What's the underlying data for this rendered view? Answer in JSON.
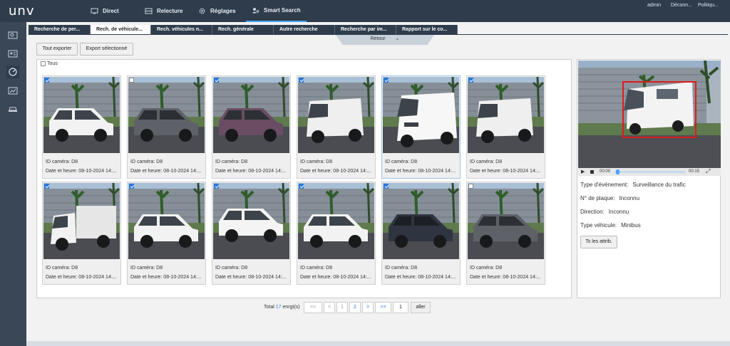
{
  "header": {
    "logo": "unv",
    "nav": [
      {
        "label": "Direct",
        "icon": "monitor-icon"
      },
      {
        "label": "Relecture",
        "icon": "film-icon"
      },
      {
        "label": "Réglages",
        "icon": "gear-icon"
      },
      {
        "label": "Smart Search",
        "icon": "person-search-icon"
      }
    ],
    "user": "admin",
    "logout": "Déconn...",
    "policy": "Politiqu..."
  },
  "sidebar": {
    "items": [
      "face-search-icon",
      "id-card-icon",
      "gauge-icon",
      "chart-icon",
      "car-icon"
    ]
  },
  "tabs": [
    "Recherche de per...",
    "Rech. de véhicule...",
    "Rech. véhicules n...",
    "Rech. générale",
    "Autre recherche",
    "Recherche par im...",
    "Rapport sur le co..."
  ],
  "retour": "Retour",
  "toolbar": {
    "export_all": "Tout exporter",
    "export_selected": "Export sélectionné"
  },
  "select_all": "Tous",
  "cards": [
    {
      "camera": "ID caméra: D8",
      "datetime": "Date et heure: 08-10-2024 14:...",
      "checked": true,
      "vehicle": "hatch-white"
    },
    {
      "camera": "ID caméra: D8",
      "datetime": "Date et heure: 08-10-2024 14:...",
      "checked": false,
      "vehicle": "car-grey"
    },
    {
      "camera": "ID caméra: D8",
      "datetime": "Date et heure: 08-10-2024 14:...",
      "checked": true,
      "vehicle": "car-purple"
    },
    {
      "camera": "ID caméra: D8",
      "datetime": "Date et heure: 08-10-2024 14:...",
      "checked": true,
      "vehicle": "van-small"
    },
    {
      "camera": "ID caméra: D8",
      "datetime": "Date et heure: 08-10-2024 14:...",
      "checked": true,
      "vehicle": "van-big"
    },
    {
      "camera": "ID caméra: D8",
      "datetime": "Date et heure: 08-10-2024 14:...",
      "checked": true,
      "vehicle": "van-small"
    },
    {
      "camera": "ID caméra: D8",
      "datetime": "Date et heure: 08-10-2024 14:...",
      "checked": true,
      "vehicle": "truck-white"
    },
    {
      "camera": "ID caméra: D8",
      "datetime": "Date et heure: 08-10-2024 14:...",
      "checked": true,
      "vehicle": "hatch-white"
    },
    {
      "camera": "ID caméra: D8",
      "datetime": "Date et heure: 08-10-2024 14:...",
      "checked": true,
      "vehicle": "suv-white"
    },
    {
      "camera": "ID caméra: D8",
      "datetime": "Date et heure: 08-10-2024 14:...",
      "checked": true,
      "vehicle": "hatch-white"
    },
    {
      "camera": "ID caméra: D8",
      "datetime": "Date et heure: 08-10-2024 14:...",
      "checked": true,
      "vehicle": "car-dark"
    },
    {
      "camera": "ID caméra: D8",
      "datetime": "Date et heure: 08-10-2024 14:...",
      "checked": false,
      "vehicle": "car-grey"
    }
  ],
  "pagination": {
    "total_prefix": "Total",
    "total": "17",
    "total_suffix": "enrgt(s)",
    "first": "<<",
    "prev": "<",
    "page1": "1",
    "page2": "2",
    "next": ">",
    "last": ">>",
    "goto_value": "1",
    "go": "aller"
  },
  "detail": {
    "time_start": "00:00",
    "time_end": "00:15",
    "event_type_label": "Type d'événement:",
    "event_type": "Surveillance du trafic",
    "plate_label": "N° de plaque:",
    "plate": "Inconnu",
    "direction_label": "Direction:",
    "direction": "Inconnu",
    "vehicle_type_label": "Type véhicule:",
    "vehicle_type": "Minibus",
    "attrs_button": "Ts les attrib."
  },
  "colors": {
    "topbar": "#2e3c4c",
    "accent": "#2a78d6",
    "detection_box": "#e01b1b"
  }
}
